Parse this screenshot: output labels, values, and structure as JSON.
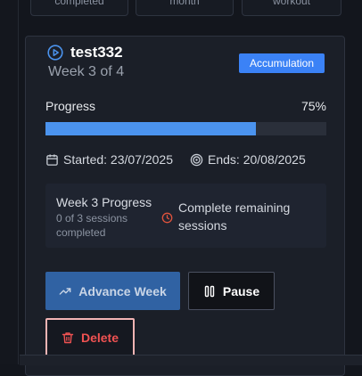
{
  "top_stats": [
    "completed",
    "month",
    "workout"
  ],
  "program": {
    "name": "test332",
    "week_label": "Week 3 of 4",
    "phase": "Accumulation",
    "progress_label": "Progress",
    "progress_percent_text": "75%",
    "progress_fraction": 0.75,
    "started": "Started: 23/07/2025",
    "ends": "Ends: 20/08/2025"
  },
  "week_box": {
    "title": "Week 3 Progress",
    "sessions": "0 of 3 sessions completed",
    "status": "Complete remaining sessions"
  },
  "actions": {
    "advance": "Advance Week",
    "pause": "Pause",
    "delete": "Delete"
  },
  "colors": {
    "accent": "#3b82f6",
    "progress": "#4b93ee",
    "danger": "#f05252",
    "warning": "#e0533d"
  }
}
